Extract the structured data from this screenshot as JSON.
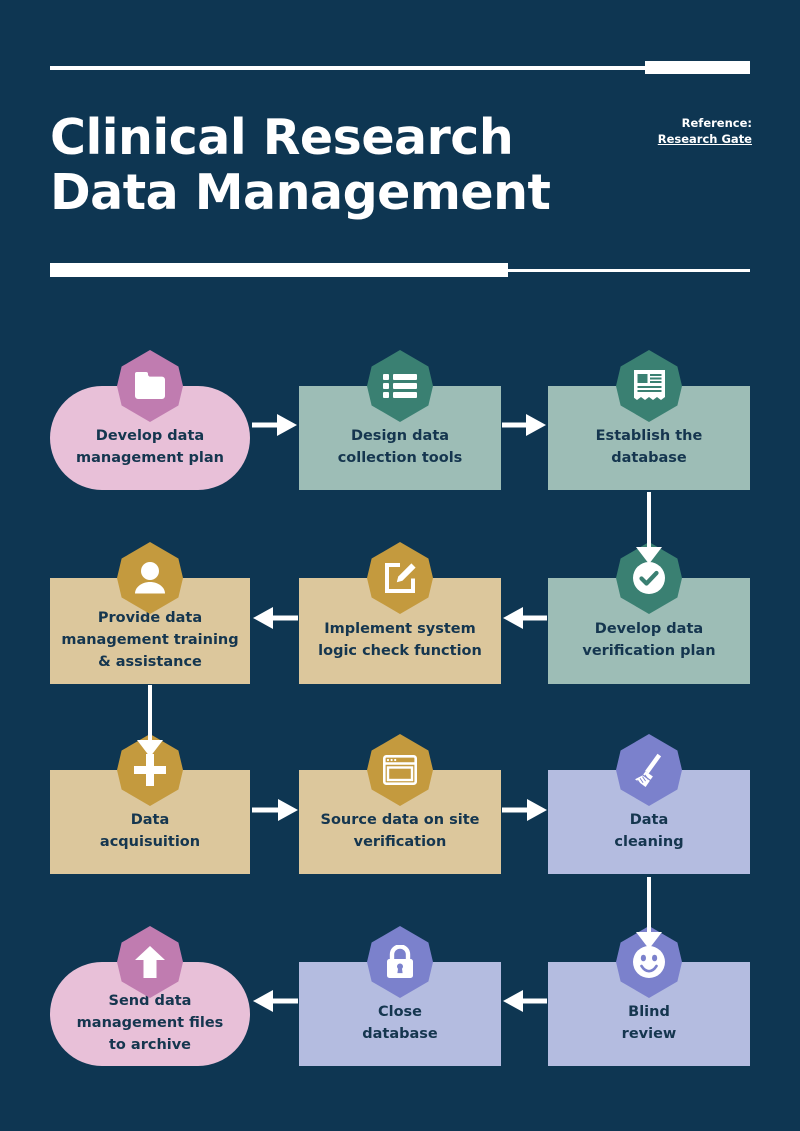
{
  "page": {
    "background_color": "#0e3652",
    "title_line1": "Clinical Research",
    "title_line2": "Data Management"
  },
  "reference": {
    "label": "Reference:",
    "link_text": "Research Gate "
  },
  "palette": {
    "navy": "#0e3652",
    "text_dark": "#15364f",
    "white": "#ffffff",
    "pink_fill": "#e8c0d8",
    "pink_badge": "#c07cb0",
    "sage_fill": "#9dbdb6",
    "sage_badge": "#3a8072",
    "tan_fill": "#dcc79c",
    "tan_badge": "#c49a3e",
    "periwinkle_fill": "#b4bce0",
    "periwinkle_badge": "#7b81cc"
  },
  "flow": {
    "nodes": [
      {
        "id": "develop-data-management-plan",
        "label": "Develop data\nmanagement plan",
        "icon": "folder-icon",
        "shape": "blob",
        "fill": "#e8c0d8",
        "badge": "#c07cb0"
      },
      {
        "id": "design-data-collection-tools",
        "label": "Design data\ncollection tools",
        "icon": "list-icon",
        "shape": "rect",
        "fill": "#9dbdb6",
        "badge": "#3a8072"
      },
      {
        "id": "establish-the-database",
        "label": "Establish the\ndatabase",
        "icon": "document-icon",
        "shape": "rect",
        "fill": "#9dbdb6",
        "badge": "#3a8072"
      },
      {
        "id": "provide-data-management-training",
        "label": "Provide data\nmanagement training\n& assistance",
        "icon": "user-icon",
        "shape": "rect",
        "fill": "#dcc79c",
        "badge": "#c49a3e"
      },
      {
        "id": "implement-system-logic-check",
        "label": "Implement system\nlogic check function",
        "icon": "edit-icon",
        "shape": "rect",
        "fill": "#dcc79c",
        "badge": "#c49a3e"
      },
      {
        "id": "develop-data-verification-plan",
        "label": "Develop data\nverification plan",
        "icon": "check-circle-icon",
        "shape": "rect",
        "fill": "#9dbdb6",
        "badge": "#3a8072"
      },
      {
        "id": "data-acquisuition",
        "label": "Data\nacquisuition",
        "icon": "plus-icon",
        "shape": "rect",
        "fill": "#dcc79c",
        "badge": "#c49a3e"
      },
      {
        "id": "source-data-on-site-verification",
        "label": "Source data on site\nverification",
        "icon": "browser-window-icon",
        "shape": "rect",
        "fill": "#dcc79c",
        "badge": "#c49a3e"
      },
      {
        "id": "data-cleaning",
        "label": "Data\ncleaning",
        "icon": "broom-icon",
        "shape": "rect",
        "fill": "#b4bce0",
        "badge": "#7b81cc"
      },
      {
        "id": "send-data-management-files-to-archive",
        "label": "Send data\nmanagement files\nto archive",
        "icon": "upload-arrow-icon",
        "shape": "blob",
        "fill": "#e8c0d8",
        "badge": "#c07cb0"
      },
      {
        "id": "close-database",
        "label": "Close\ndatabase",
        "icon": "lock-icon",
        "shape": "rect",
        "fill": "#b4bce0",
        "badge": "#7b81cc"
      },
      {
        "id": "blind-review",
        "label": "Blind\nreview",
        "icon": "smiley-face-icon",
        "shape": "rect",
        "fill": "#b4bce0",
        "badge": "#7b81cc"
      }
    ],
    "connectors": [
      {
        "id": "c1",
        "from": "develop-data-management-plan",
        "to": "design-data-collection-tools",
        "direction": "right"
      },
      {
        "id": "c2",
        "from": "design-data-collection-tools",
        "to": "establish-the-database",
        "direction": "right"
      },
      {
        "id": "c3",
        "from": "establish-the-database",
        "to": "develop-data-verification-plan",
        "direction": "down"
      },
      {
        "id": "c4",
        "from": "develop-data-verification-plan",
        "to": "implement-system-logic-check",
        "direction": "left"
      },
      {
        "id": "c5",
        "from": "implement-system-logic-check",
        "to": "provide-data-management-training",
        "direction": "left"
      },
      {
        "id": "c6",
        "from": "provide-data-management-training",
        "to": "data-acquisuition",
        "direction": "down"
      },
      {
        "id": "c7",
        "from": "data-acquisuition",
        "to": "source-data-on-site-verification",
        "direction": "right"
      },
      {
        "id": "c8",
        "from": "source-data-on-site-verification",
        "to": "data-cleaning",
        "direction": "right"
      },
      {
        "id": "c9",
        "from": "data-cleaning",
        "to": "blind-review",
        "direction": "down"
      },
      {
        "id": "c10",
        "from": "blind-review",
        "to": "close-database",
        "direction": "left"
      },
      {
        "id": "c11",
        "from": "close-database",
        "to": "send-data-management-files-to-archive",
        "direction": "left"
      }
    ]
  }
}
